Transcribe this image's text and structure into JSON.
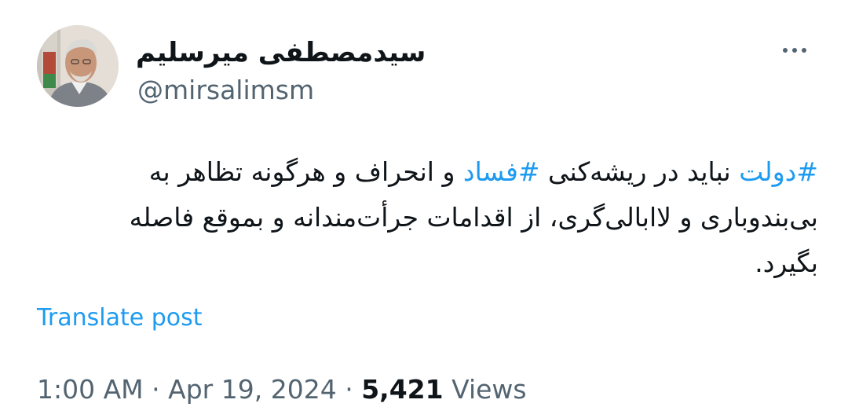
{
  "author": {
    "display_name": "سیدمصطفی میرسلیم",
    "handle": "@mirsalimsm"
  },
  "more_menu": {
    "icon": "more-icon"
  },
  "tweet": {
    "segments": [
      {
        "text": "#دولت",
        "hashtag": true
      },
      {
        "text": " نباید در ریشه‌کنی ",
        "hashtag": false
      },
      {
        "text": "#فساد",
        "hashtag": true
      },
      {
        "text": " و انحراف و هرگونه تظاهر به بی‌بندوباری و لاابالی‌گری، از اقدامات جرأت‌مندانه و بموقع فاصله بگیرد.",
        "hashtag": false
      }
    ],
    "translate_label": "Translate post"
  },
  "meta": {
    "time": "1:00 AM",
    "separator": "·",
    "date": "Apr 19, 2024",
    "views_count": "5,421",
    "views_label": "Views"
  },
  "colors": {
    "accent": "#1d9bf0",
    "text": "#0f1419",
    "secondary_text": "#536471"
  }
}
